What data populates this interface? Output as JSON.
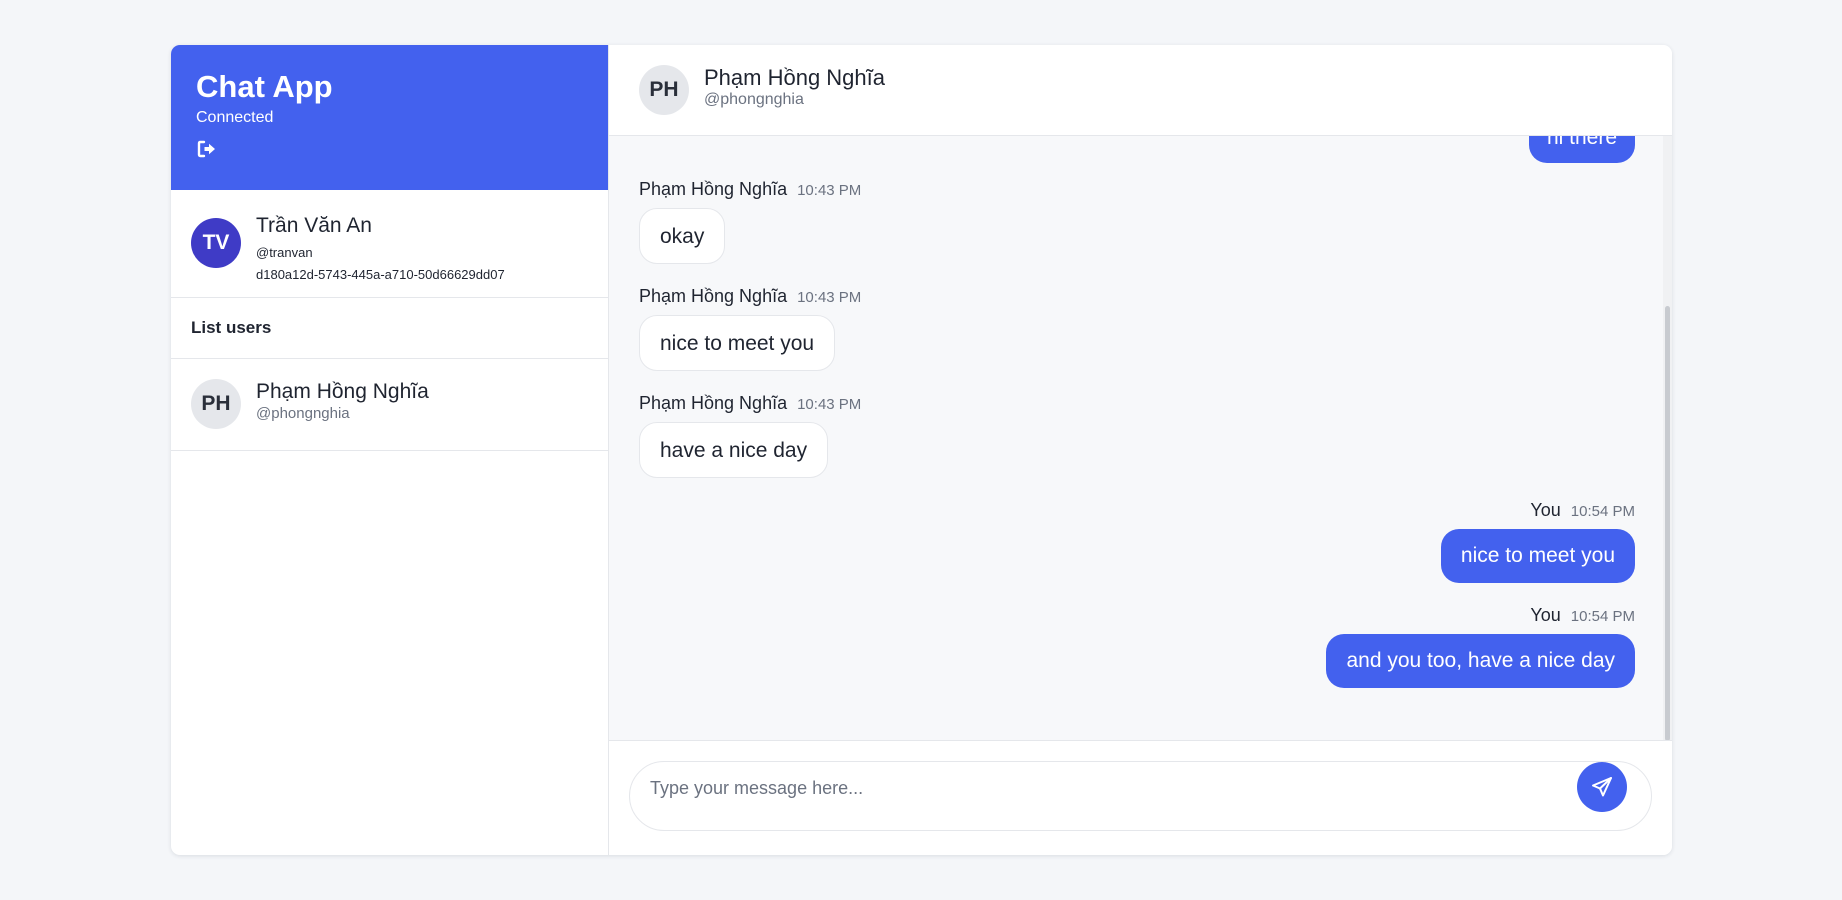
{
  "app": {
    "title": "Chat App",
    "status": "Connected",
    "colors": {
      "accent": "#4361ee",
      "me_avatar": "#3f3bc6",
      "background": "#f4f6f9"
    }
  },
  "me": {
    "initials": "TV",
    "name": "Trần Văn An",
    "handle": "@tranvan",
    "id": "d180a12d-5743-445a-a710-50d66629dd07"
  },
  "users": {
    "title": "List users",
    "items": [
      {
        "initials": "PH",
        "name": "Phạm Hồng Nghĩa",
        "handle": "@phongnghia"
      }
    ]
  },
  "chat": {
    "partner": {
      "initials": "PH",
      "name": "Phạm Hồng Nghĩa",
      "handle": "@phongnghia"
    },
    "messages": [
      {
        "direction": "out",
        "text": "hi there",
        "partial": true
      },
      {
        "direction": "in",
        "sender": "Phạm Hồng Nghĩa",
        "time": "10:43 PM",
        "text": "okay"
      },
      {
        "direction": "in",
        "sender": "Phạm Hồng Nghĩa",
        "time": "10:43 PM",
        "text": "nice to meet you"
      },
      {
        "direction": "in",
        "sender": "Phạm Hồng Nghĩa",
        "time": "10:43 PM",
        "text": "have a nice day"
      },
      {
        "direction": "out",
        "sender": "You",
        "time": "10:54 PM",
        "text": "nice to meet you"
      },
      {
        "direction": "out",
        "sender": "You",
        "time": "10:54 PM",
        "text": "and you too, have a nice day"
      }
    ],
    "composer": {
      "placeholder": "Type your message here...",
      "value": ""
    }
  },
  "icons": {
    "logout": "logout-icon",
    "send": "send-icon"
  }
}
